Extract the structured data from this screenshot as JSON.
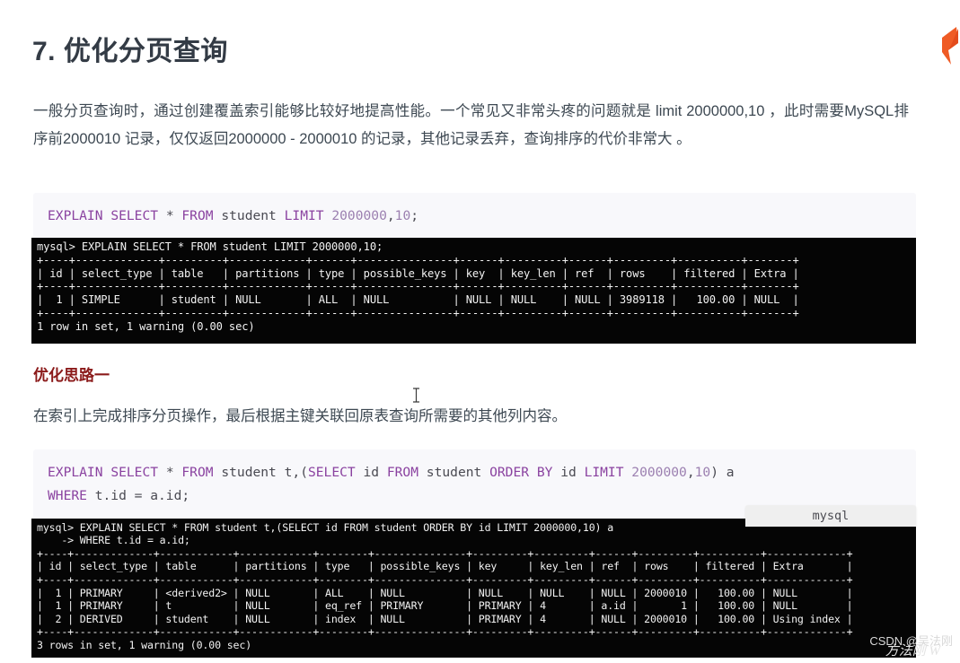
{
  "document": {
    "heading": "7. 优化分页查询",
    "paragraph_1": "一般分页查询时，通过创建覆盖索引能够比较好地提高性能。一个常见又非常头疼的问题就是 limit 2000000,10 ，此时需要MySQL排序前2000010 记录，仅仅返回2000000 - 2000010 的记录，其他记录丢弃，查询排序的代价非常大 。",
    "subheading": "优化思路一",
    "paragraph_2": "在索引上完成排序分页操作，最后根据主键关联回原表查询所需要的其他列内容。"
  },
  "code_block_1": {
    "language": "sql",
    "text": "EXPLAIN SELECT * FROM student LIMIT 2000000,10;"
  },
  "code_block_2": {
    "language": "sql",
    "line_1": "EXPLAIN SELECT * FROM student t,(SELECT id FROM student ORDER BY id LIMIT 2000000,10) a",
    "line_2": "WHERE t.id = a.id;"
  },
  "terminal_1": {
    "text": "mysql> EXPLAIN SELECT * FROM student LIMIT 2000000,10;\n+----+-------------+---------+------------+------+---------------+------+---------+------+---------+----------+-------+\n| id | select_type | table   | partitions | type | possible_keys | key  | key_len | ref  | rows    | filtered | Extra |\n+----+-------------+---------+------------+------+---------------+------+---------+------+---------+----------+-------+\n|  1 | SIMPLE      | student | NULL       | ALL  | NULL          | NULL | NULL    | NULL | 3989118 |   100.00 | NULL  |\n+----+-------------+---------+------------+------+---------------+------+---------+------+---------+----------+-------+\n1 row in set, 1 warning (0.00 sec)"
  },
  "terminal_2": {
    "badge": "mysql",
    "text": "mysql> EXPLAIN SELECT * FROM student t,(SELECT id FROM student ORDER BY id LIMIT 2000000,10) a\n    -> WHERE t.id = a.id;\n+----+-------------+------------+------------+--------+---------------+---------+---------+------+---------+----------+-------------+\n| id | select_type | table      | partitions | type   | possible_keys | key     | key_len | ref  | rows    | filtered | Extra       |\n+----+-------------+------------+------------+--------+---------------+---------+---------+------+---------+----------+-------------+\n|  1 | PRIMARY     | <derived2> | NULL       | ALL    | NULL          | NULL    | NULL    | NULL | 2000010 |   100.00 | NULL        |\n|  1 | PRIMARY     | t          | NULL       | eq_ref | PRIMARY       | PRIMARY | 4       | a.id |       1 |   100.00 | NULL        |\n|  2 | DERIVED     | student    | NULL       | index  | NULL          | PRIMARY | 4       | NULL | 2000010 |   100.00 | Using index |\n+----+-------------+------------+------------+--------+---------------+---------+---------+------+---------+----------+-------------+\n3 rows in set, 1 warning (0.00 sec)"
  },
  "watermark": {
    "text_1": "CSDN @吴法刚",
    "text_2": "方法刚 W"
  },
  "colors": {
    "heading": "#333b45",
    "subheading": "#8b1a1a",
    "code_bg": "#f8f8fb",
    "keyword": "#8a42a0",
    "terminal_bg": "#050505",
    "logo_accent": "#ef5b25"
  }
}
